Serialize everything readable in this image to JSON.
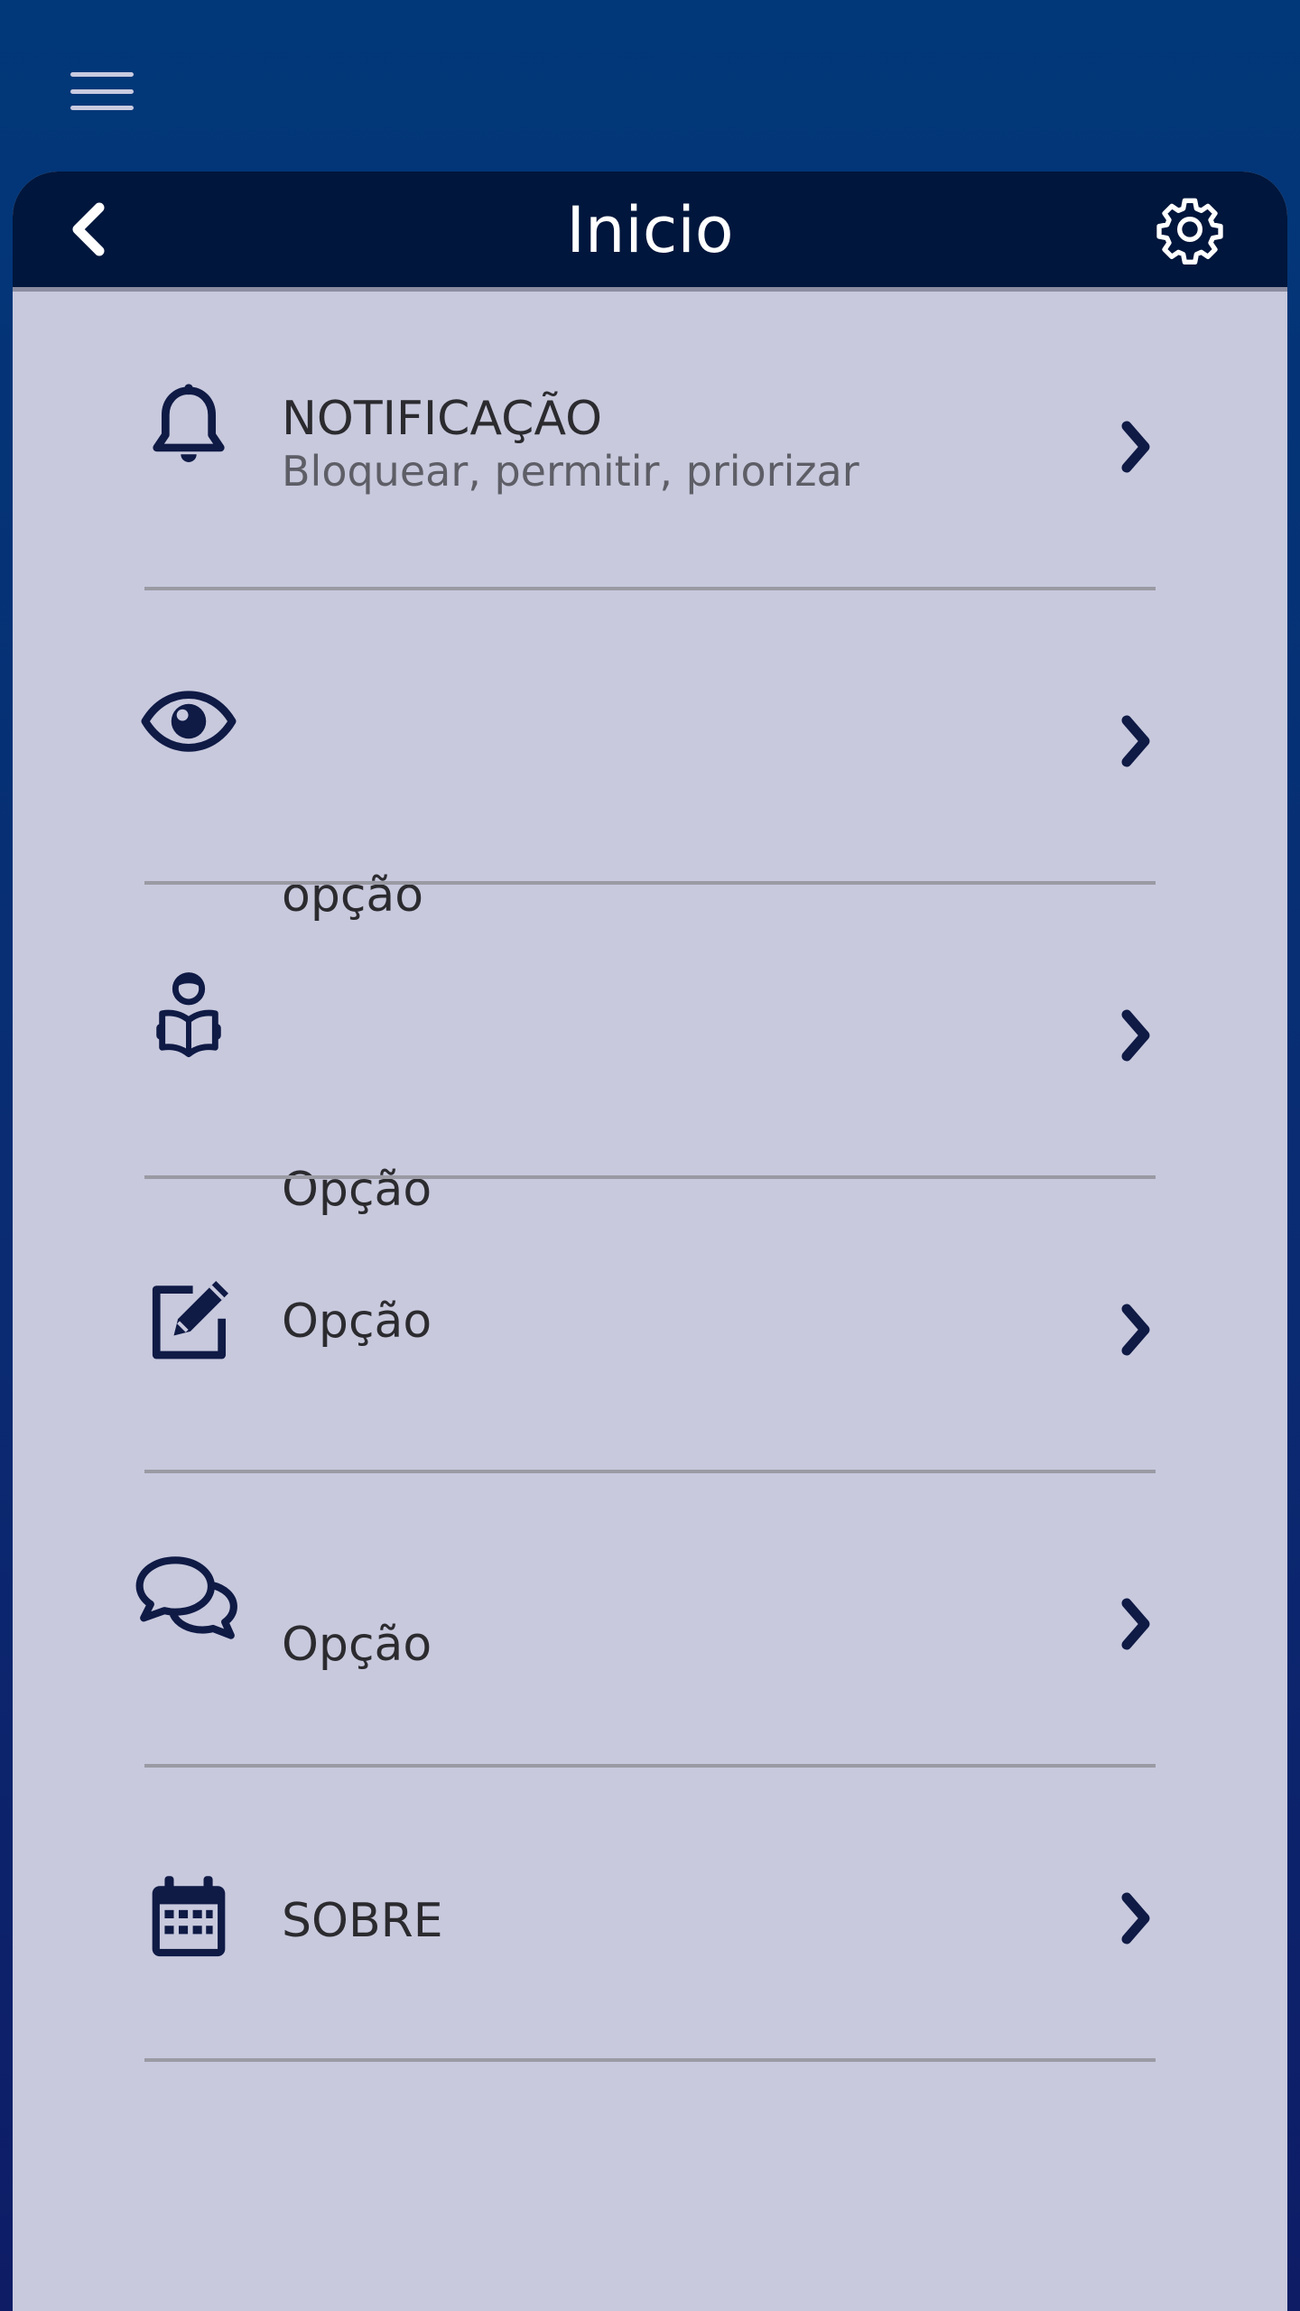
{
  "header": {
    "title": "Inicio"
  },
  "menu": [
    {
      "label": "NOTIFICAÇÃO",
      "sublabel": "Bloquear, permitir, priorizar",
      "icon": "bell-icon"
    },
    {
      "label": "opção",
      "icon": "eye-icon"
    },
    {
      "label": "Opção",
      "icon": "reader-icon"
    },
    {
      "label": "Opção",
      "icon": "edit-icon"
    },
    {
      "label": "Opção",
      "icon": "chat-icon"
    },
    {
      "label": "SOBRE",
      "icon": "calendar-icon"
    }
  ],
  "colors": {
    "background_top": "#013879",
    "background_bottom": "#0e1c66",
    "header": "#00163c",
    "panel": "#c8c9dd",
    "icon": "#0f1a45",
    "text": "#2b2b2f"
  }
}
